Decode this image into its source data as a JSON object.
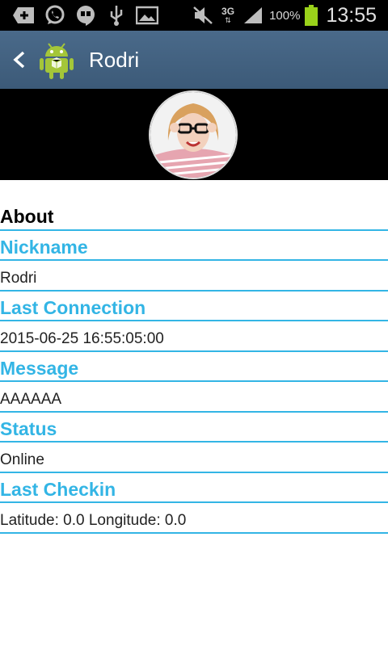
{
  "status_bar": {
    "battery_percent": "100%",
    "time": "13:55",
    "network": "3G",
    "icons": [
      "add-icon",
      "whatsapp-icon",
      "hangouts-icon",
      "usb-icon",
      "image-icon",
      "mute-icon",
      "3g-icon",
      "signal-icon",
      "battery-icon"
    ]
  },
  "action_bar": {
    "title": "Rodri",
    "icons": [
      "back-icon",
      "android-app-icon"
    ]
  },
  "profile": {
    "about_heading": "About",
    "fields": [
      {
        "label": "Nickname",
        "value": "Rodri"
      },
      {
        "label": "Last Connection",
        "value": "2015-06-25 16:55:05:00"
      },
      {
        "label": "Message",
        "value": "AAAAAA"
      },
      {
        "label": "Status",
        "value": "Online"
      },
      {
        "label": "Last Checkin",
        "value": "Latitude: 0.0 Longitude: 0.0"
      }
    ]
  },
  "colors": {
    "accent": "#33b5e5",
    "action_bar": "#4a6a8a",
    "battery": "#9ad21a"
  }
}
